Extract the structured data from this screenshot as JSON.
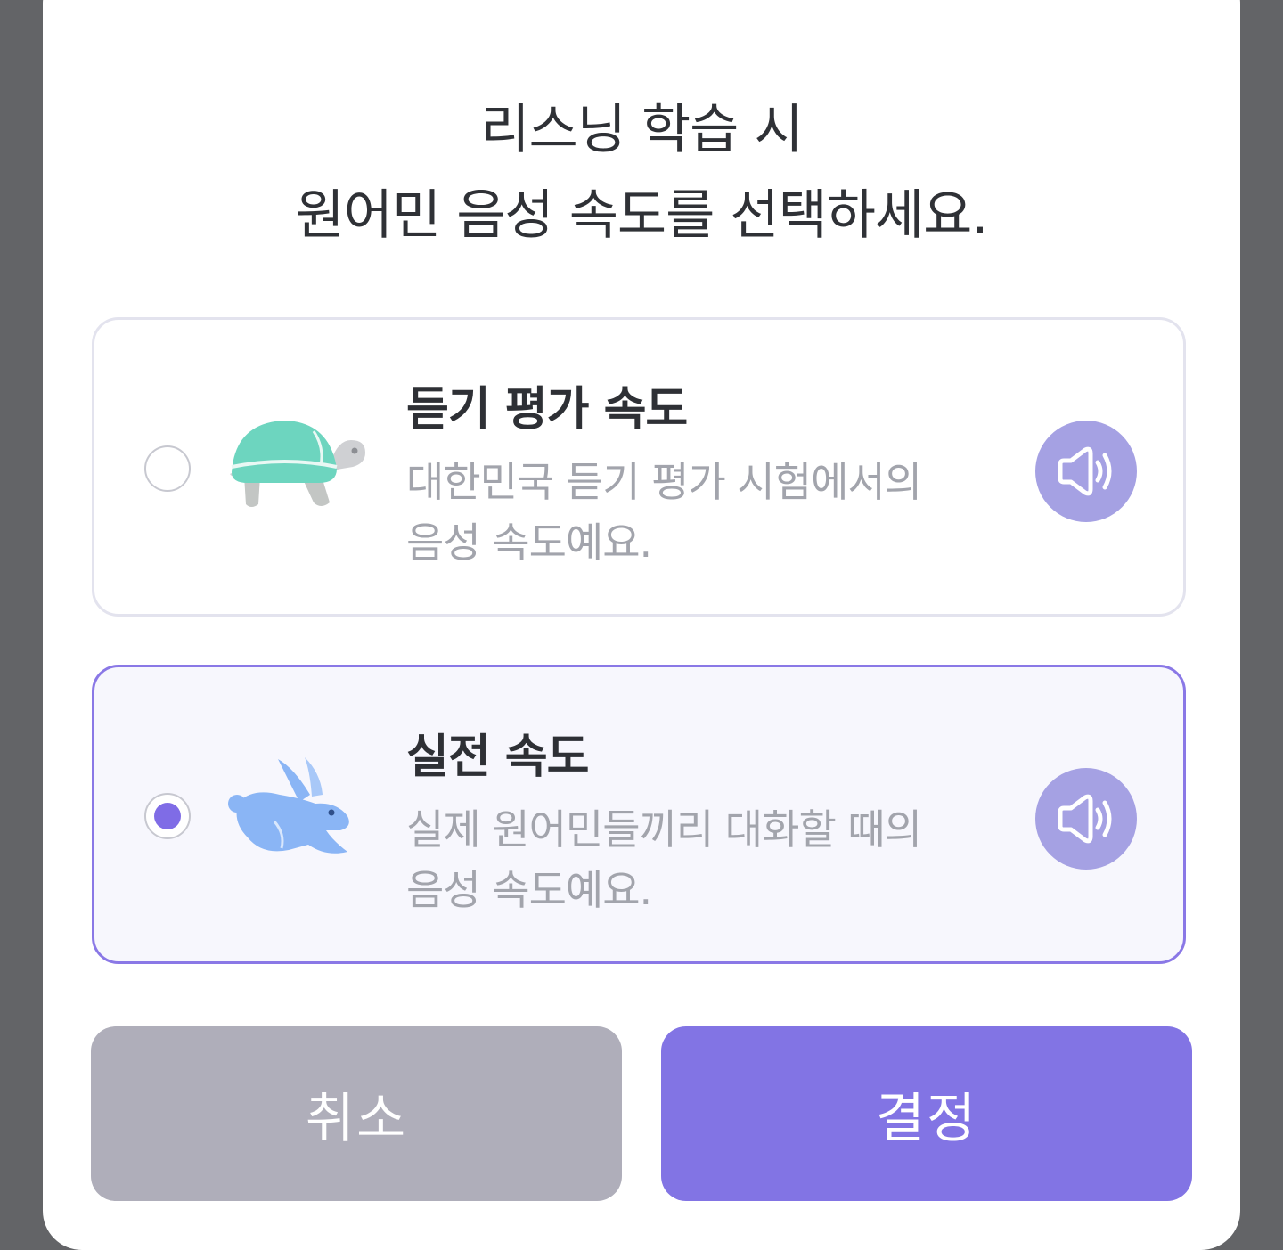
{
  "dialog": {
    "title_line1": "리스닝 학습 시",
    "title_line2": "원어민 음성 속도를 선택하세요."
  },
  "options": [
    {
      "title": "듣기 평가 속도",
      "desc_line1": "대한민국 듣기 평가 시험에서의",
      "desc_line2": "음성 속도예요.",
      "icon": "turtle-icon",
      "selected": false
    },
    {
      "title": "실전 속도",
      "desc_line1": "실제 원어민들끼리 대화할 때의",
      "desc_line2": "음성 속도예요.",
      "icon": "rabbit-icon",
      "selected": true
    }
  ],
  "buttons": {
    "cancel": "취소",
    "confirm": "결정"
  },
  "colors": {
    "accent": "#8274e4",
    "selected_border": "#8a78e6",
    "sound_button": "#a5a1e3",
    "cancel_button": "#afaeba",
    "turtle_shell": "#6dd5bf",
    "rabbit": "#8ab5f5"
  }
}
